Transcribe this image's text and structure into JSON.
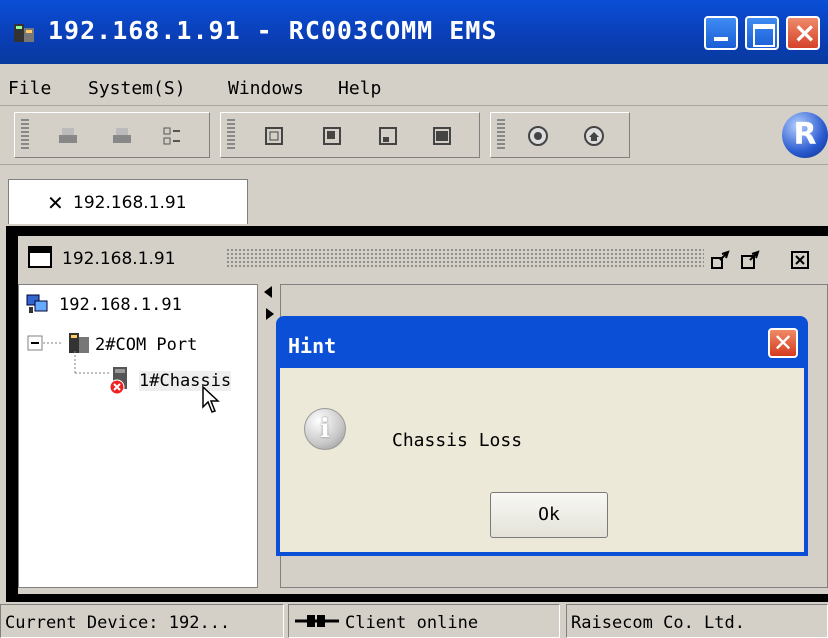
{
  "window": {
    "title": "192.168.1.91 - RC003COMM EMS",
    "icon": "network-device-icon"
  },
  "menu": {
    "items": [
      "File",
      "System(S)",
      "Windows",
      "Help"
    ]
  },
  "toolbar": {
    "logo_text": "R"
  },
  "tabs": [
    {
      "label": "192.168.1.91",
      "close_glyph": "✕"
    }
  ],
  "frame": {
    "title": "192.168.1.91"
  },
  "tree": {
    "root": "192.168.1.91",
    "child": "2#COM Port",
    "leaf": "1#Chassis"
  },
  "dialog": {
    "title": "Hint",
    "message": "Chassis Loss",
    "ok_label": "Ok",
    "close_glyph": "✕",
    "icon": "info-icon"
  },
  "status": {
    "device": "Current Device: 192...",
    "connection": "Client online",
    "company": "Raisecom Co. Ltd."
  },
  "colors": {
    "titlebar": "#0a4fd6",
    "chrome": "#d4d0c8",
    "dialog_body": "#ece9d8"
  }
}
